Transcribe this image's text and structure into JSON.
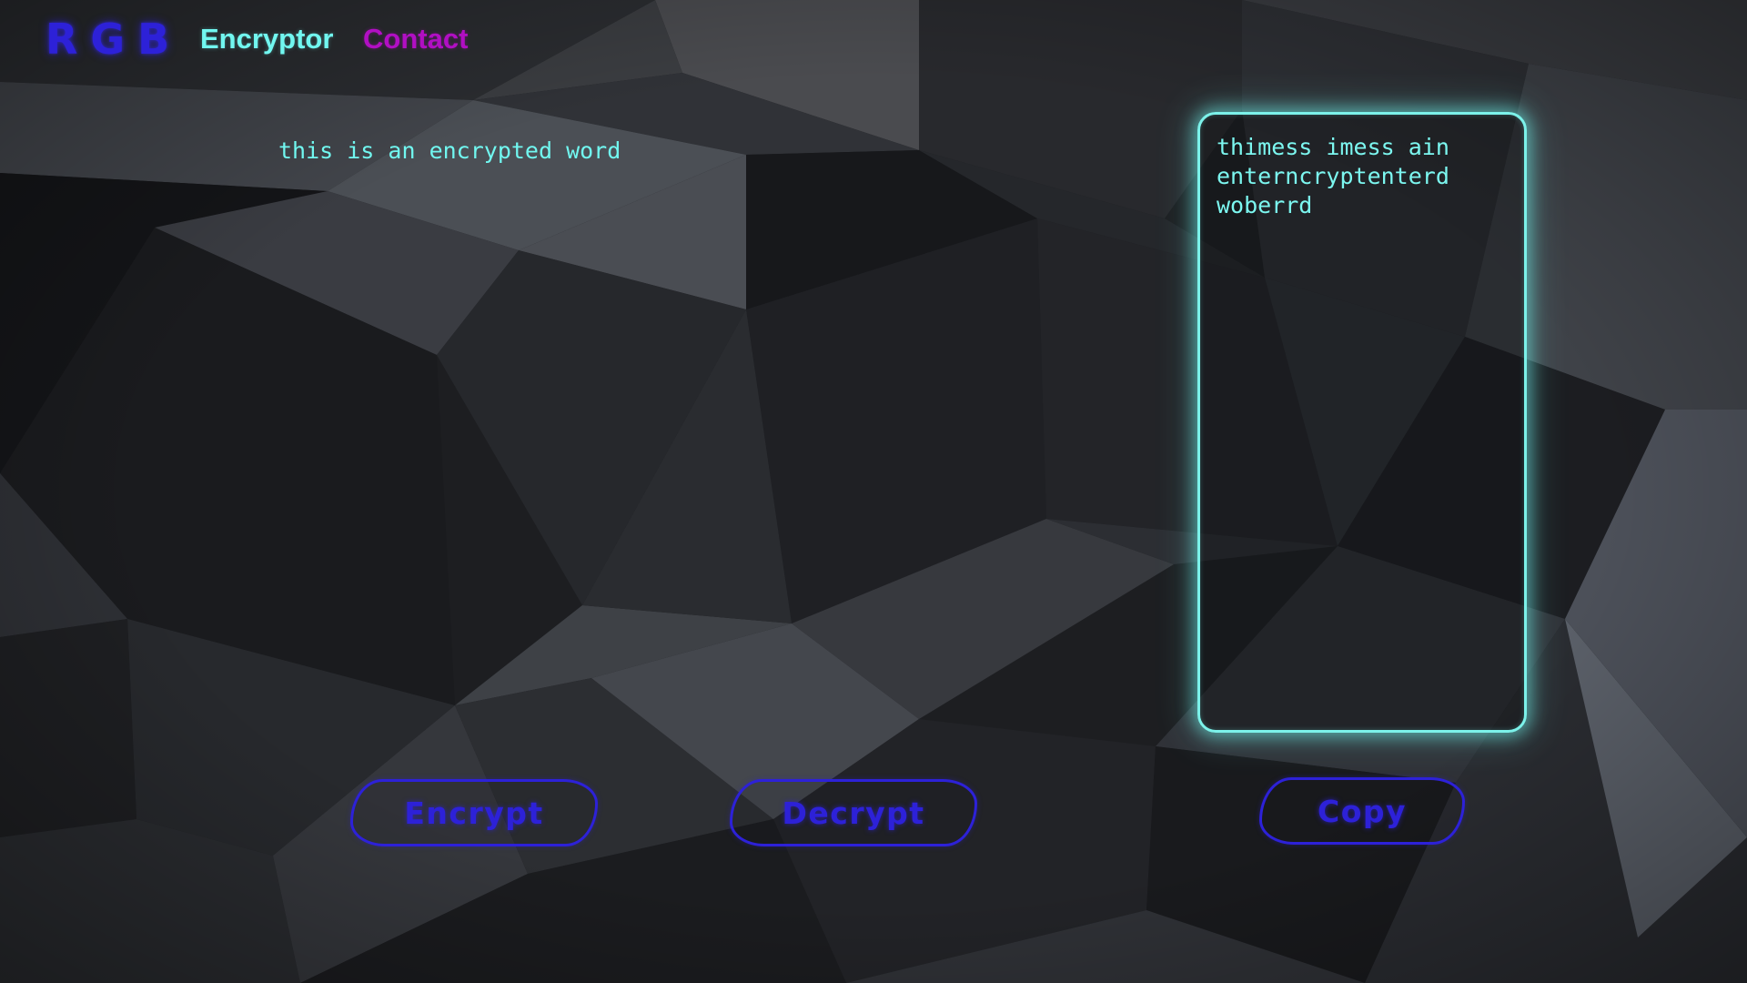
{
  "brand": {
    "logo_text": "RGB",
    "logo_color": "#2d21d8"
  },
  "nav": {
    "items": [
      {
        "label": "Encryptor",
        "color": "#71f7f0",
        "active": true
      },
      {
        "label": "Contact",
        "color": "#b10fc3",
        "active": false
      }
    ]
  },
  "input": {
    "value": "this is an encrypted word",
    "text_color": "#71f7f0"
  },
  "output": {
    "value": "thimess imess ain enterncryptenterd woberrd",
    "border_color": "#7cf2ea"
  },
  "buttons": {
    "encrypt_label": "Encrypt",
    "decrypt_label": "Decrypt",
    "copy_label": "Copy",
    "color": "#2d21d8"
  },
  "background": {
    "style": "dark low-poly triangles"
  }
}
